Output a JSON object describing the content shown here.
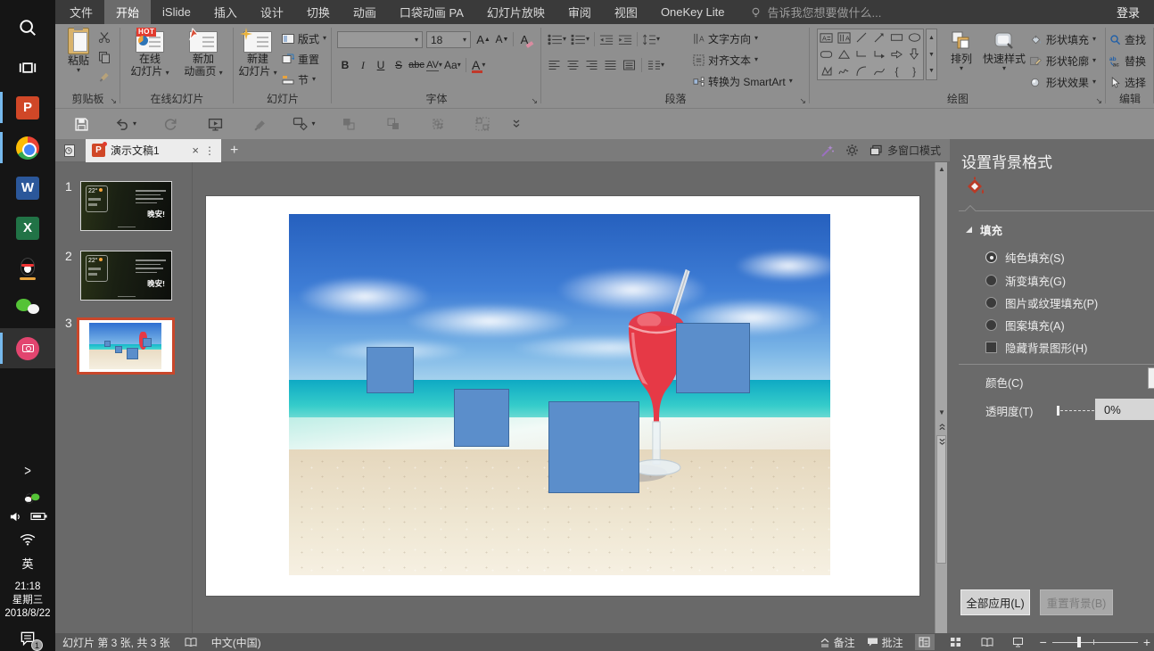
{
  "window": {
    "login_label": "登录",
    "tell_me_hint": "告诉我您想要做什么..."
  },
  "menu": {
    "items": [
      "文件",
      "开始",
      "iSlide",
      "插入",
      "设计",
      "切换",
      "动画",
      "口袋动画 PA",
      "幻灯片放映",
      "审阅",
      "视图",
      "OneKey Lite"
    ]
  },
  "ribbon": {
    "clipboard": {
      "paste": "粘贴",
      "group_label": "剪贴板"
    },
    "online": {
      "hot_badge": "HOT",
      "online_l1": "在线",
      "online_l2": "幻灯片",
      "anim_l1": "新加",
      "anim_l2": "动画页",
      "group_label": "在线幻灯片"
    },
    "slides": {
      "new_l1": "新建",
      "new_l2": "幻灯片",
      "layout": "版式",
      "reset": "重置",
      "section": "节",
      "group_label": "幻灯片"
    },
    "font": {
      "name_value": "",
      "size_value": "18",
      "bold": "B",
      "italic": "I",
      "underline": "U",
      "strike": "S",
      "abc": "abc",
      "spacing": "AV",
      "case": "Aa",
      "color": "A",
      "group_label": "字体"
    },
    "paragraph": {
      "text_direction": "文字方向",
      "align_text": "对齐文本",
      "smartart": "转换为 SmartArt",
      "group_label": "段落"
    },
    "drawing": {
      "arrange": "排列",
      "quick_styles": "快速样式",
      "fill": "形状填充",
      "outline": "形状轮廓",
      "effects": "形状效果",
      "group_label": "绘图"
    },
    "editing": {
      "find": "查找",
      "replace": "替换",
      "select": "选择",
      "group_label": "编辑"
    }
  },
  "tabbar": {
    "document_title": "演示文稿1",
    "multi_window_label": "多窗口模式"
  },
  "thumbnails": {
    "slide1": {
      "num": "1",
      "widget_temp": "22°",
      "greeting": "晚安!"
    },
    "slide2": {
      "num": "2",
      "widget_temp": "22°",
      "greeting": "晚安!"
    },
    "slide3": {
      "num": "3"
    }
  },
  "inspector": {
    "title": "设置背景格式",
    "section_fill": "填充",
    "fill_options": [
      {
        "label": "纯色填充(S)",
        "selected": true
      },
      {
        "label": "渐变填充(G)",
        "selected": false
      },
      {
        "label": "图片或纹理填充(P)",
        "selected": false
      },
      {
        "label": "图案填充(A)",
        "selected": false
      }
    ],
    "hide_bg_label": "隐藏背景图形(H)",
    "color_label": "颜色(C)",
    "transparency_label": "透明度(T)",
    "transparency_value": "0%",
    "apply_all": "全部应用(L)",
    "reset_bg": "重置背景(B)"
  },
  "statusbar": {
    "slide_counter": "幻灯片 第 3 张, 共 3 张",
    "language": "中文(中国)",
    "notes": "备注",
    "comments": "批注"
  },
  "taskbar": {
    "time": "21:18",
    "weekday": "星期三",
    "date": "2018/8/22",
    "ime": "英",
    "notification_count": "1"
  },
  "colors": {
    "square_fill": "#5B8ECB",
    "square_border": "#3D6A9E",
    "slide_selection": "#C9472B",
    "hot_badge": "#E23B2E",
    "taskbar_active_bar": "#76B9ED"
  }
}
